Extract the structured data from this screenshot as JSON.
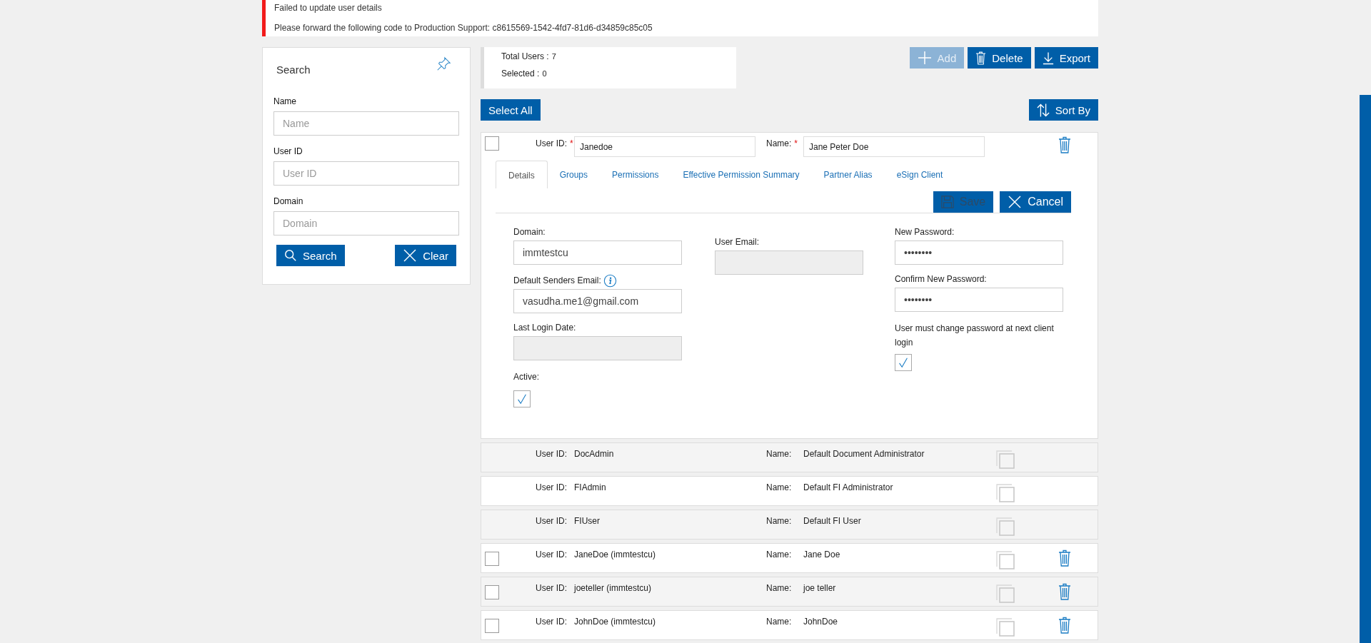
{
  "alert": {
    "lines": [
      "Failed to update user details",
      "Please forward the following code to Production Support: c8615569-1542-4fd7-81d6-d34859c85c05"
    ]
  },
  "search_panel": {
    "title": "Search",
    "fields": [
      {
        "label": "Name",
        "placeholder": "Name"
      },
      {
        "label": "User ID",
        "placeholder": "User ID"
      },
      {
        "label": "Domain",
        "placeholder": "Domain"
      }
    ],
    "buttons": [
      {
        "kind": "search",
        "label": "Search"
      },
      {
        "kind": "clear",
        "label": "Clear"
      }
    ]
  },
  "summary": [
    {
      "label": "Total Users :",
      "value": "7"
    },
    {
      "label": "Selected :",
      "value": "0"
    }
  ],
  "toolbar": [
    {
      "kind": "add",
      "label": "Add",
      "disabled": true
    },
    {
      "kind": "delete",
      "label": "Delete",
      "disabled": false
    },
    {
      "kind": "export",
      "label": "Export",
      "disabled": false
    }
  ],
  "select_all": "Select All",
  "sort_by": "Sort By",
  "editor": {
    "checked": false,
    "user_id_label": "User ID:",
    "name_label": "Name:",
    "required_mark": "*",
    "user_id": "Janedoe",
    "name": "Jane Peter Doe",
    "tabs": [
      {
        "label": "Details",
        "selected": true
      },
      {
        "label": "Groups",
        "selected": false
      },
      {
        "label": "Permissions",
        "selected": false
      },
      {
        "label": "Effective Permission Summary",
        "selected": false
      },
      {
        "label": "Partner Alias",
        "selected": false
      },
      {
        "label": "eSign Client",
        "selected": false
      }
    ],
    "actions": [
      {
        "kind": "save",
        "label": "Save",
        "disabled": true
      },
      {
        "kind": "cancel",
        "label": "Cancel",
        "disabled": false
      }
    ],
    "columns": [
      [
        {
          "kind": "field",
          "label": "Domain:",
          "value": "immtestcu",
          "disabled": false
        },
        {
          "kind": "field",
          "label": "Default Senders Email:",
          "value": "vasudha.me1@gmail.com",
          "disabled": false,
          "info": true
        },
        {
          "kind": "field",
          "label": "Last Login Date:",
          "disabled": true
        },
        {
          "kind": "checkbox",
          "label": "Active:",
          "checked": true
        }
      ],
      [
        {
          "kind": "field",
          "label": "User Email:",
          "disabled": true
        }
      ],
      [
        {
          "kind": "field",
          "label": "New Password:",
          "value": "••••••••",
          "disabled": false
        },
        {
          "kind": "field",
          "label": "Confirm New Password:",
          "value": "••••••••",
          "disabled": false
        },
        {
          "kind": "checkbox",
          "label": "User must change password at next client login",
          "checked": true
        }
      ]
    ]
  },
  "rows": [
    {
      "user_id_label": "User ID:",
      "user_id": "DocAdmin",
      "name_label": "Name:",
      "name": "Default Document Administrator",
      "selectable": false,
      "deletable": false
    },
    {
      "user_id_label": "User ID:",
      "user_id": "FIAdmin",
      "name_label": "Name:",
      "name": "Default FI Administrator",
      "selectable": false,
      "deletable": false
    },
    {
      "user_id_label": "User ID:",
      "user_id": "FIUser",
      "name_label": "Name:",
      "name": "Default FI User",
      "selectable": false,
      "deletable": false
    },
    {
      "user_id_label": "User ID:",
      "user_id": "JaneDoe (immtestcu)",
      "name_label": "Name:",
      "name": "Jane Doe",
      "selectable": true,
      "checked": false,
      "deletable": true
    },
    {
      "user_id_label": "User ID:",
      "user_id": "joeteller (immtestcu)",
      "name_label": "Name:",
      "name": "joe teller",
      "selectable": true,
      "checked": false,
      "deletable": true
    },
    {
      "user_id_label": "User ID:",
      "user_id": "JohnDoe (immtestcu)",
      "name_label": "Name:",
      "name": "JohnDoe",
      "selectable": true,
      "checked": false,
      "deletable": true
    }
  ]
}
